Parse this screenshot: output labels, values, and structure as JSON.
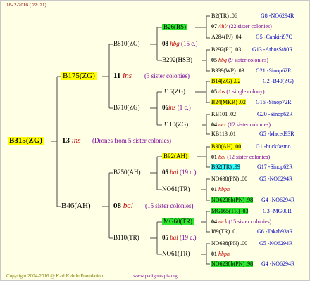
{
  "header": {
    "date": "18-  2-2016 ( 22: 21)"
  },
  "footer": {
    "copyright": "Copyright 2004-2016 @ Karl Kehrle Foundation.",
    "url": "www.pedigreeapis.org"
  },
  "root": {
    "name": "B315(ZG)",
    "count": "13",
    "ins": "ins",
    "note": "(Drones from 5 sister colonies)"
  },
  "g1": [
    {
      "name": "B175(ZG)",
      "count": "11",
      "ins": "ins",
      "note": "(3 sister colonies)"
    },
    {
      "name": "B46(AH)",
      "count": "08",
      "ins": "bal",
      "note": "(15 sister colonies)"
    }
  ],
  "g2": [
    {
      "name": "B810(ZG)",
      "count": "08",
      "ins": "hbg",
      "note": "(15 c.)"
    },
    {
      "name": "B710(ZG)",
      "count": "06",
      "ins": "ins",
      "note": "(1 c.)"
    },
    {
      "name": "B250(AH)",
      "count": "05",
      "ins": "bal",
      "note": "(19 c.)"
    },
    {
      "name": "B110(TR)",
      "count": "05",
      "ins": "bal",
      "note": "(19 c.)"
    }
  ],
  "g3": [
    {
      "name": "B26(RS)"
    },
    {
      "name": "B292(HSB)"
    },
    {
      "name": "B15(ZG)"
    },
    {
      "name": "B110(ZG)"
    },
    {
      "name": "B92(AH)"
    },
    {
      "name": "NO61(TR)"
    },
    {
      "name": "MG60(TR)"
    },
    {
      "name": "NO61(TR)"
    }
  ],
  "g4": [
    {
      "a": "B2(TR) .06",
      "b": "G8 -NO6294R"
    },
    {
      "a": "07",
      "b": "/thl/",
      "c": "(22 sister colonies)"
    },
    {
      "a": "A284(PJ) .04",
      "b": "G5 -Cankiri97Q"
    },
    {
      "a": "B292(PJ) .03",
      "b": "G13 -AthosSt80R"
    },
    {
      "a": "05",
      "b": "hbg",
      "c": "(9 sister colonies)"
    },
    {
      "a": "B339(WP) .03",
      "b": "G21 -Sinop62R"
    },
    {
      "a": "B14(ZG) .02",
      "b": "G2 -B40(ZG)"
    },
    {
      "a": "05",
      "b": "/ns",
      "c": "(1 single colony)"
    },
    {
      "a": "B24(MKR) .02",
      "b": "G16 -Sinop72R"
    },
    {
      "a": "KB101 .02",
      "b": "G20 -Sinop62R"
    },
    {
      "a": "04",
      "b": "nex",
      "c": "(12 sister colonies)"
    },
    {
      "a": "KB113 .01",
      "b": "G5 -Maced93R"
    },
    {
      "a": "B30(AH) .00",
      "b": "G1 -buckfastno"
    },
    {
      "a": "01",
      "b": "bal",
      "c": "(12 sister colonies)"
    },
    {
      "a": "B92(TR) .99",
      "b": "G17 -Sinop62R"
    },
    {
      "a": "NO638(PN) .00",
      "b": "G5 -NO6294R"
    },
    {
      "a": "01",
      "b": "hbpn",
      "c": ""
    },
    {
      "a": "NO6238b(PN) .98",
      "b": "G4 -NO6294R"
    },
    {
      "a": "MG165(TR) .03",
      "b": "G3 -MG00R"
    },
    {
      "a": "04",
      "b": "mrk",
      "c": "(15 sister colonies)"
    },
    {
      "a": "I89(TR) .01",
      "b": "G6 -Takab93aR"
    },
    {
      "a": "NO638(PN) .00",
      "b": "G5 -NO6294R"
    },
    {
      "a": "01",
      "b": "hbpn",
      "c": ""
    },
    {
      "a": "NO6238b(PN) .98",
      "b": "G4 -NO6294R"
    }
  ],
  "colors": {
    "line": "#4a4a4a",
    "red": "#c00000",
    "blue": "#0000c0",
    "highlight_yellow": "#ffff00",
    "highlight_green": "#2ee62e",
    "highlight_cyan": "#33ffff"
  }
}
